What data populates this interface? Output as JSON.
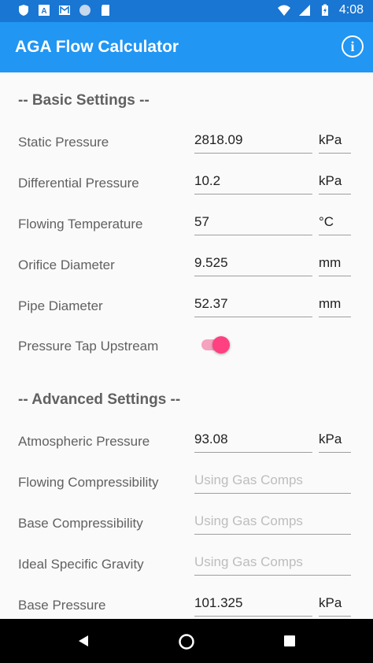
{
  "status_bar": {
    "time": "4:08"
  },
  "app_bar": {
    "title": "AGA Flow Calculator",
    "info_icon": "i"
  },
  "basic": {
    "heading": "-- Basic Settings --",
    "static_pressure": {
      "label": "Static Pressure",
      "value": "2818.09",
      "unit": "kPa"
    },
    "differential_pressure": {
      "label": "Differential Pressure",
      "value": "10.2",
      "unit": "kPa"
    },
    "flowing_temperature": {
      "label": "Flowing Temperature",
      "value": "57",
      "unit": "°C"
    },
    "orifice_diameter": {
      "label": "Orifice Diameter",
      "value": "9.525",
      "unit": "mm"
    },
    "pipe_diameter": {
      "label": "Pipe Diameter",
      "value": "52.37",
      "unit": "mm"
    },
    "pressure_tap": {
      "label": "Pressure Tap Upstream"
    }
  },
  "advanced": {
    "heading": "-- Advanced Settings --",
    "atmospheric_pressure": {
      "label": "Atmospheric Pressure",
      "value": "93.08",
      "unit": "kPa"
    },
    "flowing_compressibility": {
      "label": "Flowing Compressibility",
      "placeholder": "Using Gas Comps"
    },
    "base_compressibility": {
      "label": "Base Compressibility",
      "placeholder": "Using Gas Comps"
    },
    "ideal_specific_gravity": {
      "label": "Ideal Specific Gravity",
      "placeholder": "Using Gas Comps"
    },
    "base_pressure": {
      "label": "Base Pressure",
      "value": "101.325",
      "unit": "kPa"
    }
  }
}
